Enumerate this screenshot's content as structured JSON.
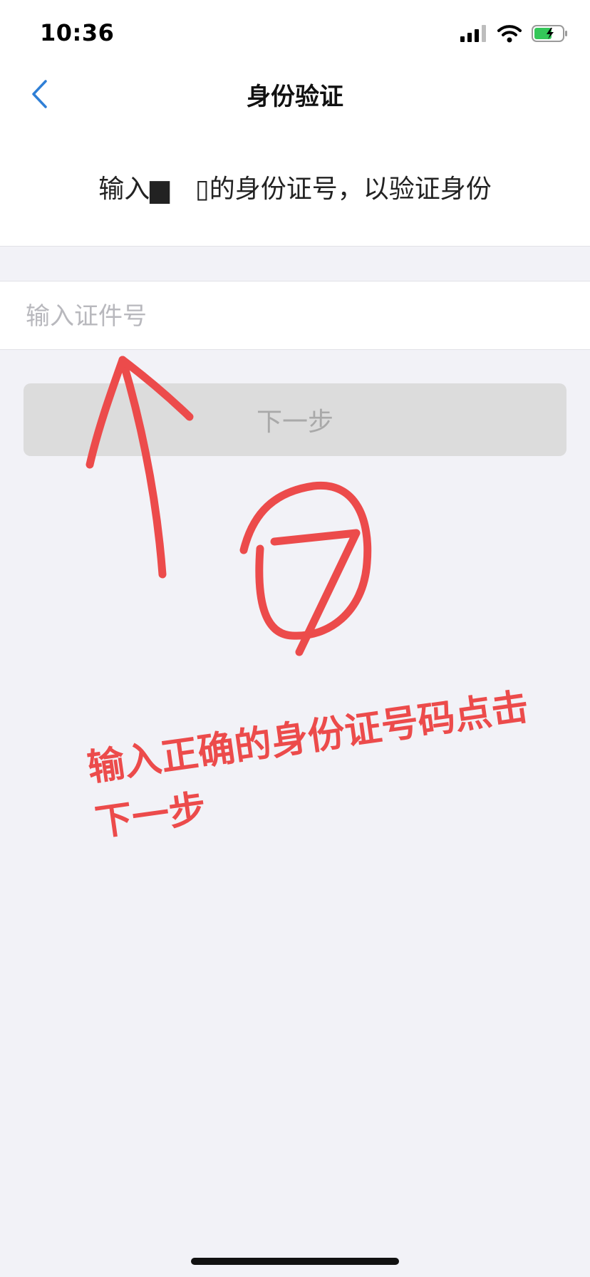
{
  "status_bar": {
    "time": "10:36"
  },
  "nav": {
    "title": "身份验证",
    "back_icon": "chevron-left-icon"
  },
  "instruction": {
    "text": "输入▆　▯的身份证号，以验证身份"
  },
  "input": {
    "value": "",
    "placeholder": "输入证件号"
  },
  "next_button": {
    "label": "下一步"
  },
  "annotation": {
    "text": "输入正确的身份证号码点击下一步",
    "color": "#ec4b4b"
  },
  "colors": {
    "accent": "#2f7fd6",
    "annotation": "#ec4b4b"
  }
}
